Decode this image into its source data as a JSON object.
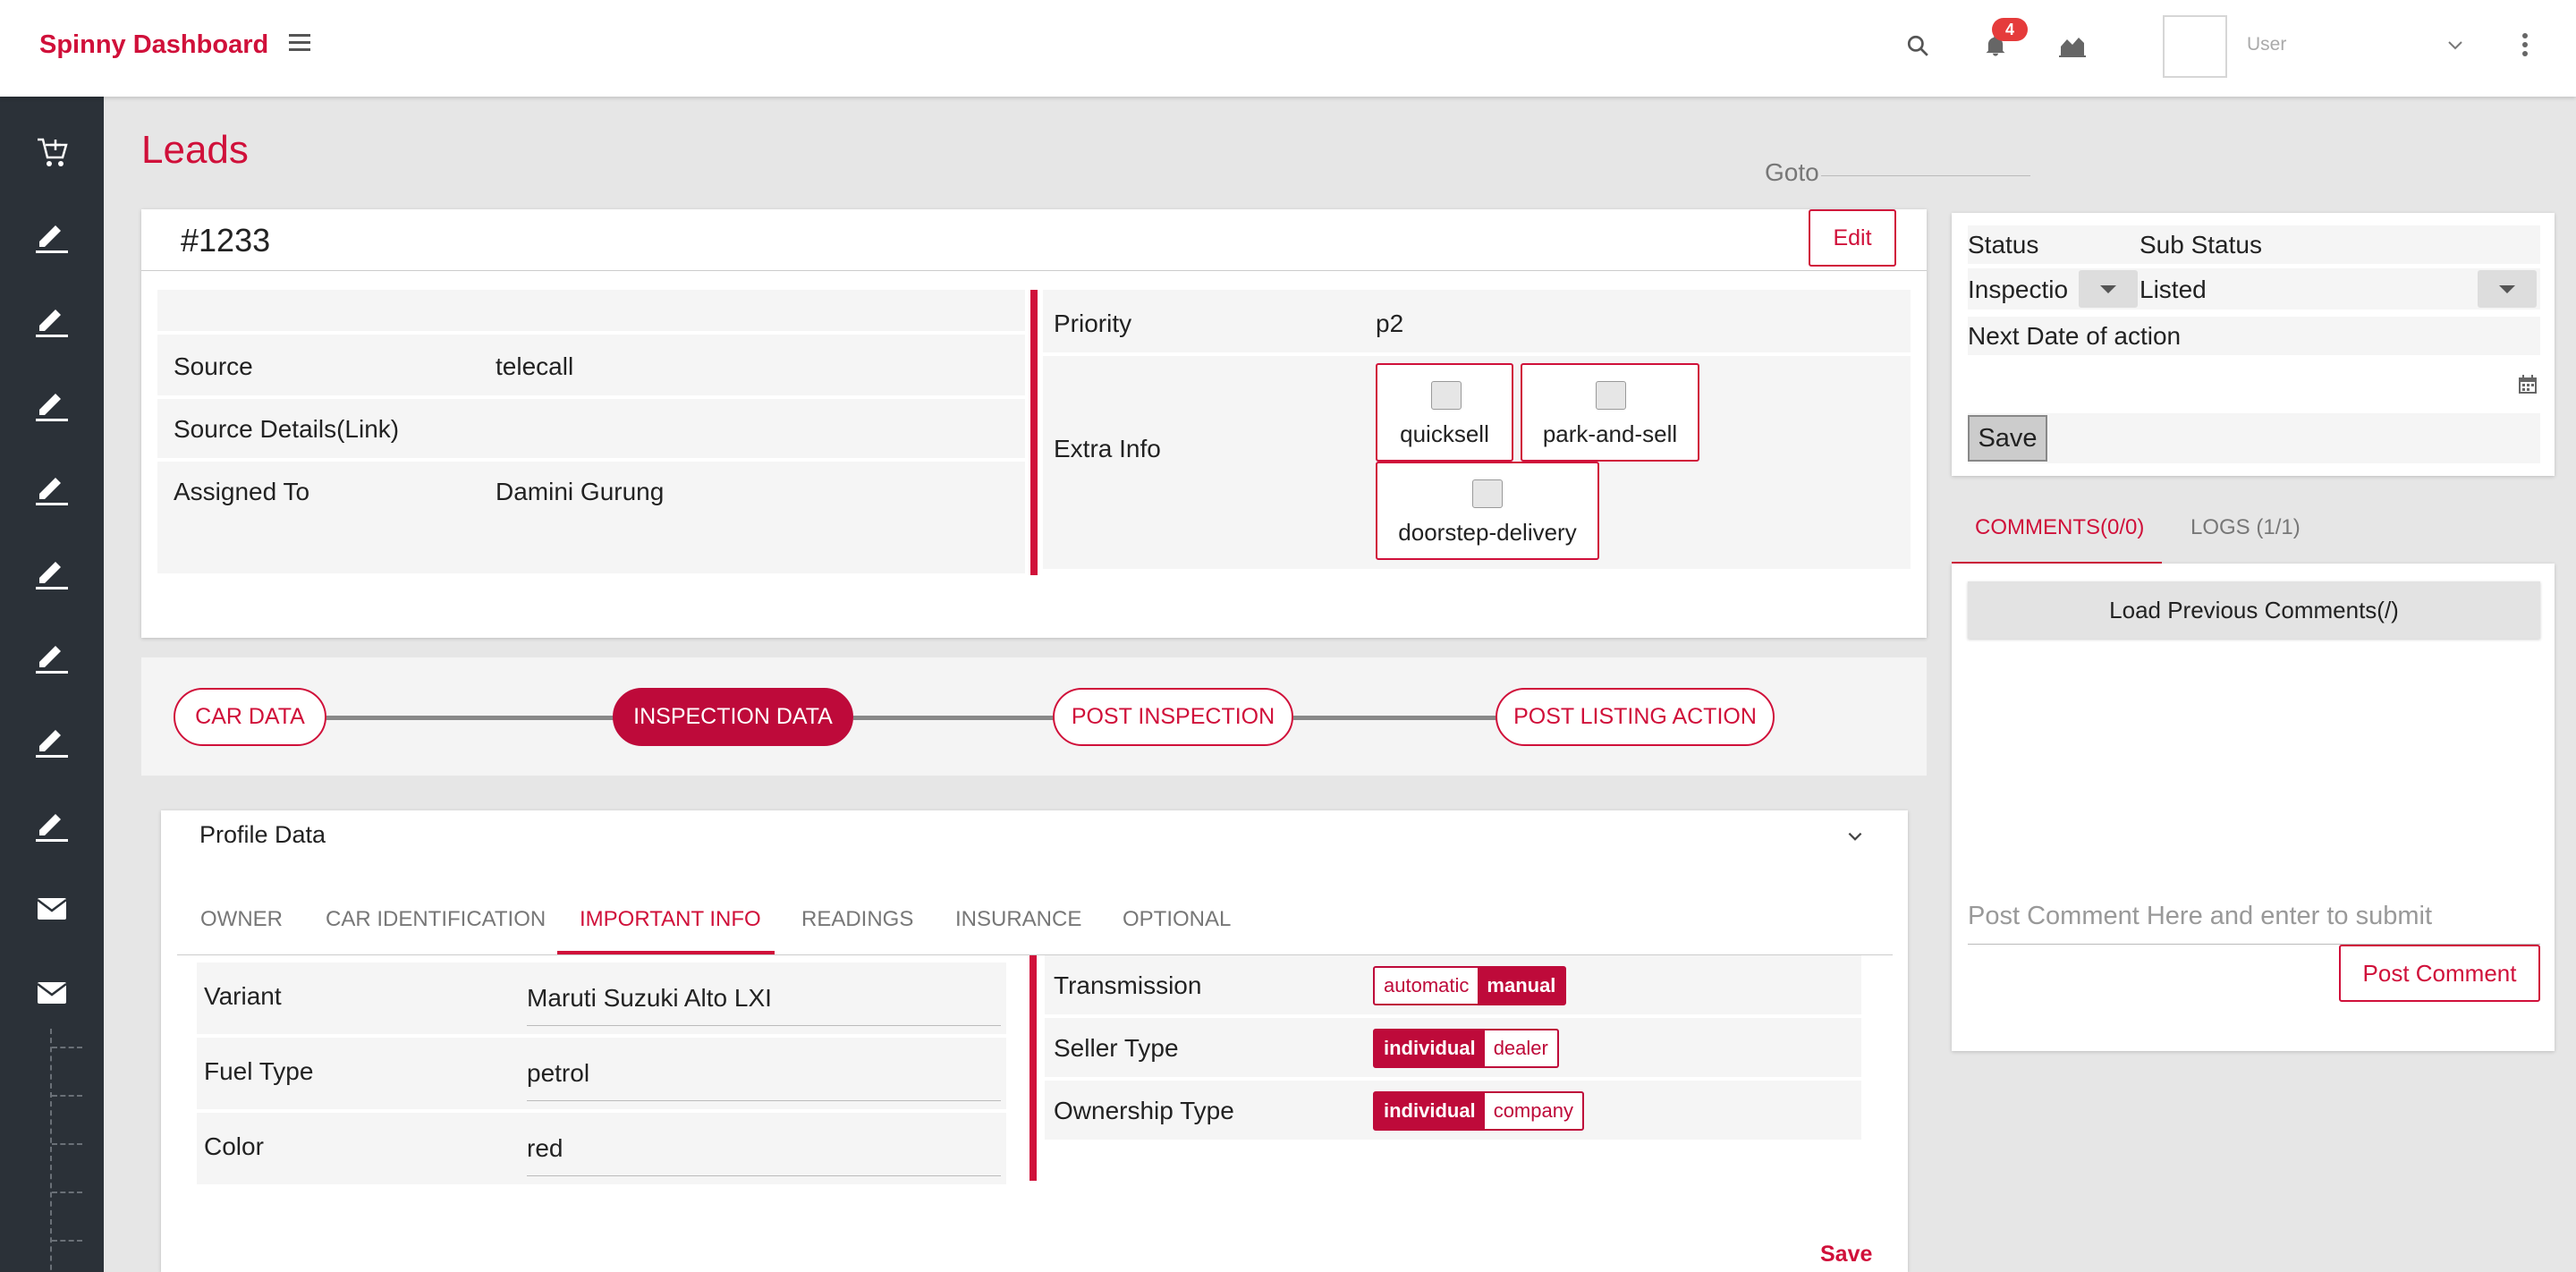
{
  "app": {
    "brand": "Spinny Dashboard",
    "notification_count": "4",
    "user_name": "User"
  },
  "page": {
    "title": "Leads",
    "goto_label": "Goto"
  },
  "lead": {
    "id": "#1233",
    "edit_label": "Edit",
    "rows_left": [
      {
        "key": "",
        "value": ""
      },
      {
        "key": "Source",
        "value": "telecall"
      },
      {
        "key": "Source Details(Link)",
        "value": ""
      },
      {
        "key": "Assigned To",
        "value": "Damini Gurung"
      }
    ],
    "priority_label": "Priority",
    "priority_value": "p2",
    "extra_info_label": "Extra Info",
    "extra_info": [
      "quicksell",
      "park-and-sell",
      "doorstep-delivery"
    ]
  },
  "stepper": {
    "steps": [
      "CAR DATA",
      "INSPECTION DATA",
      "POST INSPECTION",
      "POST LISTING ACTION"
    ],
    "active_index": 1
  },
  "profile": {
    "title": "Profile Data",
    "tabs": [
      "OWNER",
      "CAR IDENTIFICATION",
      "IMPORTANT INFO",
      "READINGS",
      "INSURANCE",
      "OPTIONAL"
    ],
    "active_tab": "IMPORTANT INFO",
    "fields": [
      {
        "key": "Variant",
        "value": "Maruti Suzuki Alto LXI"
      },
      {
        "key": "Fuel Type",
        "value": "petrol"
      },
      {
        "key": "Color",
        "value": "red"
      }
    ],
    "toggles": [
      {
        "key": "Transmission",
        "options": [
          "automatic",
          "manual"
        ],
        "selected": "manual"
      },
      {
        "key": "Seller Type",
        "options": [
          "individual",
          "dealer"
        ],
        "selected": "individual"
      },
      {
        "key": "Ownership Type",
        "options": [
          "individual",
          "company"
        ],
        "selected": "individual"
      }
    ],
    "save_label": "Save"
  },
  "status": {
    "status_label": "Status",
    "sub_status_label": "Sub Status",
    "status_value": "Inspectio",
    "sub_status_value": "Listed",
    "next_date_label": "Next Date of action",
    "save_label": "Save"
  },
  "comments": {
    "tab_comments": "COMMENTS(0/0)",
    "tab_logs": "LOGS (1/1)",
    "load_previous": "Load Previous Comments(/)",
    "placeholder": "Post Comment Here and enter to submit",
    "post_label": "Post Comment"
  },
  "colors": {
    "accent": "#d0103a",
    "accent_dark": "#be0a3a",
    "sidebar": "#2b3138",
    "background": "#e6e6e6"
  },
  "icons": {
    "topbar": [
      "menu-icon",
      "search-icon",
      "bell-icon",
      "chart-icon",
      "chevron-down-icon",
      "more-vert-icon"
    ],
    "sidebar": [
      "cart-icon",
      "edit-icon",
      "mail-icon"
    ]
  }
}
